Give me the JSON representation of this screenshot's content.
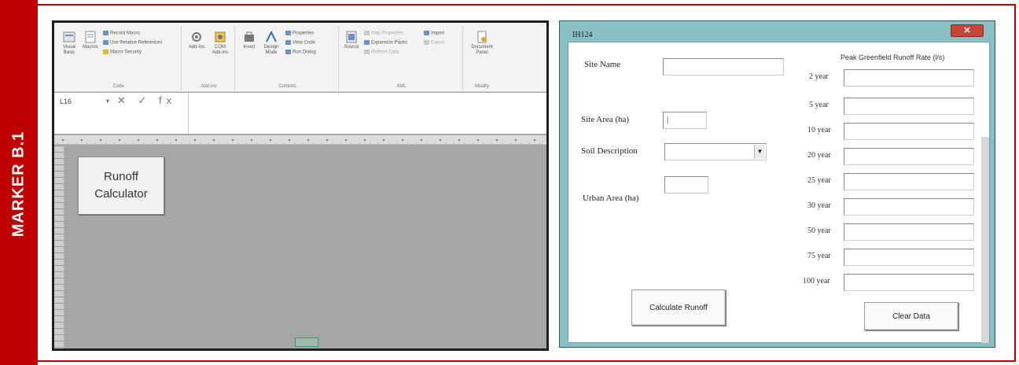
{
  "marker": {
    "label": "MARKER B.1"
  },
  "excel": {
    "ribbon": {
      "groups": [
        {
          "label": "Code"
        },
        {
          "label": "Add-ins"
        },
        {
          "label": "Controls"
        },
        {
          "label": "XML"
        },
        {
          "label": "Modify"
        }
      ],
      "buttons": {
        "visual_basic": "Visual\nBasic",
        "macros": "Macros",
        "record_macro": "Record Macro",
        "relative_refs": "Use Relative References",
        "macro_security": "Macro Security",
        "addins": "Add-ins",
        "com_addins": "COM\nAdd-ins",
        "insert": "Insert",
        "design_mode": "Design\nMode",
        "properties": "Properties",
        "view_code": "View Code",
        "run_dialog": "Run Dialog",
        "source": "Source",
        "map_properties": "Map Properties",
        "expansion_packs": "Expansion Packs",
        "refresh_data": "Refresh Data",
        "import": "Import",
        "export": "Export",
        "document_panel": "Document\nPanel"
      }
    },
    "formula_bar": {
      "name_box": "L16",
      "fx": "✕  ✓  fx",
      "value": ""
    },
    "sheet_button": {
      "label": "Runoff\nCalculator"
    }
  },
  "dialog": {
    "title": "IH124",
    "close": "✕",
    "fields": {
      "site_name_label": "Site Name",
      "site_name_value": "",
      "site_area_label": "Site Area (ha)",
      "site_area_value": "|",
      "soil_label": "Soil Description",
      "soil_value": "",
      "urban_label": "Urban Area (ha)",
      "urban_value": ""
    },
    "runoff_header": "Peak Greenfield Runoff Rate (l/s)",
    "return_periods": [
      {
        "label": "2 year",
        "value": ""
      },
      {
        "label": "5 year",
        "value": ""
      },
      {
        "label": "10 year",
        "value": ""
      },
      {
        "label": "20 year",
        "value": ""
      },
      {
        "label": "25 year",
        "value": ""
      },
      {
        "label": "30 year",
        "value": ""
      },
      {
        "label": "50 year",
        "value": ""
      },
      {
        "label": "75 year",
        "value": ""
      },
      {
        "label": "100 year",
        "value": ""
      }
    ],
    "buttons": {
      "calculate": "Calculate Runoff",
      "clear": "Clear Data"
    }
  },
  "colors": {
    "marker_red": "#c00000",
    "dialog_frame": "#88c0c4",
    "sheet_grey": "#a6a6a6"
  }
}
